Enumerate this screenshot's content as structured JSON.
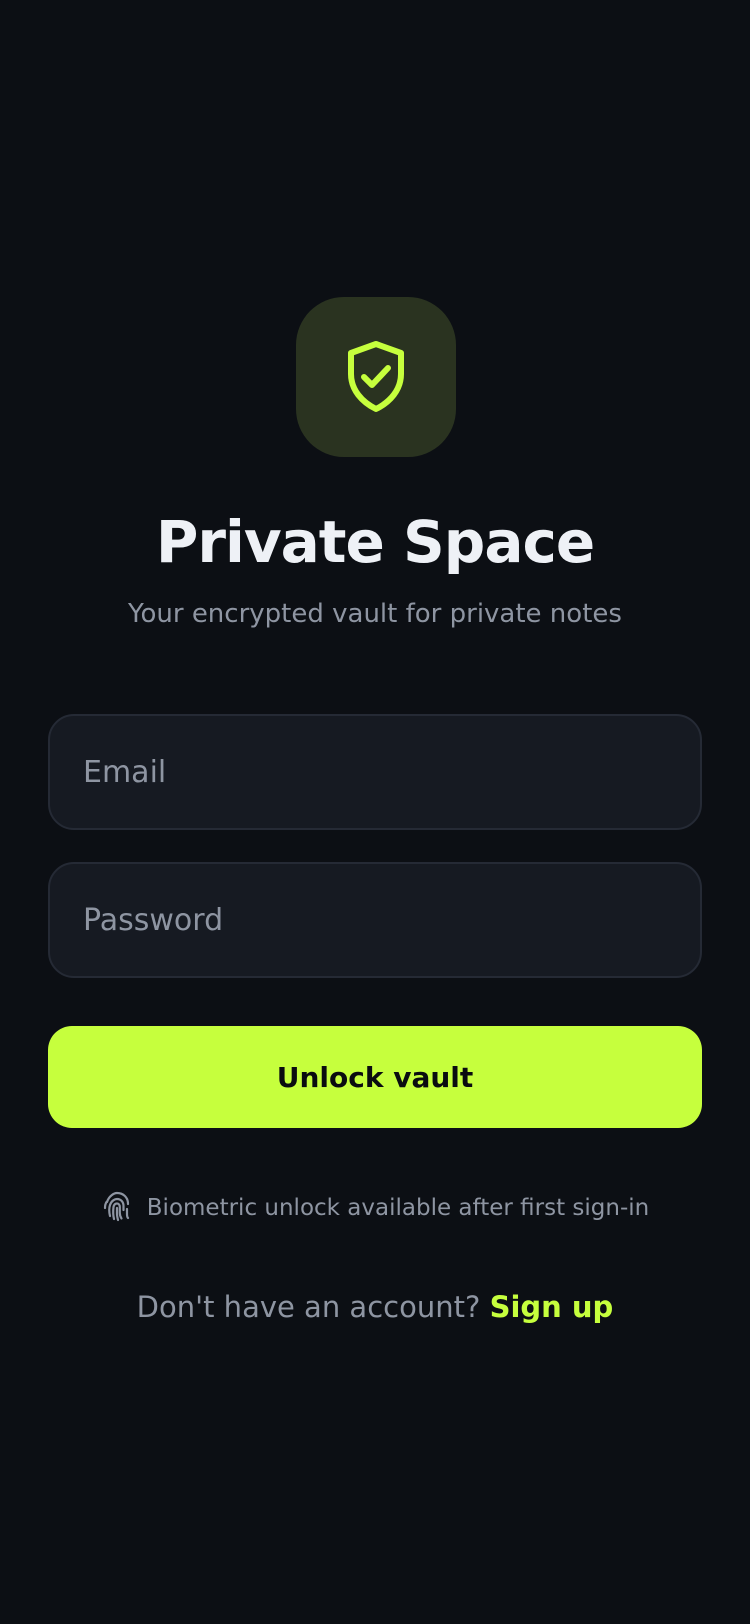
{
  "app": {
    "title": "Private Space",
    "subtitle": "Your encrypted vault for private notes",
    "logo_icon": "shield-check-icon"
  },
  "form": {
    "email_placeholder": "Email",
    "email_value": "",
    "password_placeholder": "Password",
    "password_value": "",
    "submit_label": "Unlock vault"
  },
  "biometric": {
    "icon": "fingerprint-icon",
    "text": "Biometric unlock available after first sign-in"
  },
  "signup": {
    "prompt": "Don't have an account?",
    "link_label": "Sign up"
  },
  "colors": {
    "background": "#0c0f14",
    "accent": "#c6ff3d",
    "logo_tile": "#2a3320",
    "field_bg": "#161a22",
    "field_border": "#252a35",
    "muted_text": "#8e95a2",
    "primary_text": "#eef1f6"
  }
}
